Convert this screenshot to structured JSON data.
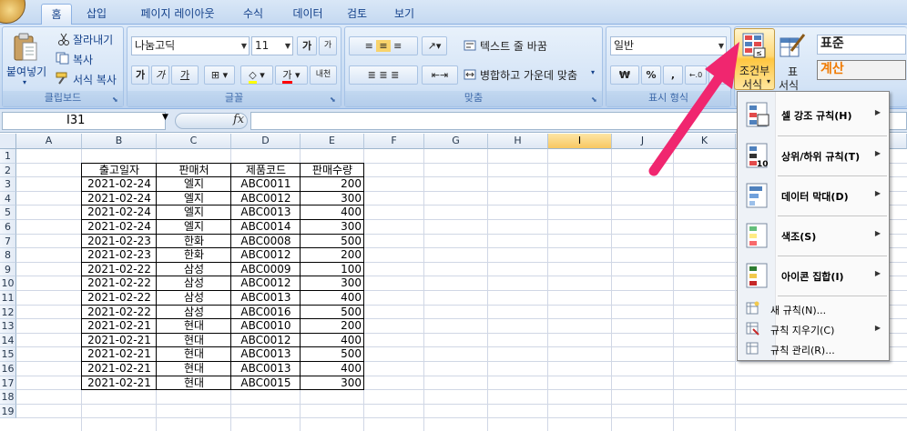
{
  "tabs": [
    {
      "label": "홈",
      "active": true
    },
    {
      "label": "삽입"
    },
    {
      "label": "페이지 레이아웃"
    },
    {
      "label": "수식"
    },
    {
      "label": "데이터"
    },
    {
      "label": "검토"
    },
    {
      "label": "보기"
    }
  ],
  "ribbon": {
    "clipboard": {
      "group_label": "클립보드",
      "paste_label": "붙여넣기",
      "cut_label": "잘라내기",
      "copy_label": "복사",
      "format_painter_label": "서식 복사"
    },
    "font": {
      "group_label": "글꼴",
      "font_name": "나눔고딕",
      "font_size": "11",
      "bold_label": "가",
      "italic_label": "가",
      "underline_label": "가",
      "grow_label": "가",
      "fontcolor_label": "가",
      "phonetic_label": "내천"
    },
    "alignment": {
      "group_label": "맞춤",
      "wrap_label": "텍스트 줄 바꿈",
      "merge_label": "병합하고 가운데 맞춤"
    },
    "number": {
      "group_label": "표시 형식",
      "format_value": "일반",
      "currency_label": "₩",
      "percent_label": "%",
      "comma_label": ","
    },
    "styles": {
      "cf_label_line1": "조건부",
      "cf_label_line2": "서식",
      "table_label_line1": "표",
      "table_label_line2": "서식",
      "style_normal": "표준",
      "style_calc": "계산"
    }
  },
  "formula_bar": {
    "name_box": "I31",
    "fx": "fx",
    "formula": ""
  },
  "columns": [
    "A",
    "B",
    "C",
    "D",
    "E",
    "F",
    "G",
    "H",
    "I",
    "J",
    "K"
  ],
  "rows": [
    "1",
    "2",
    "3",
    "4",
    "5",
    "6",
    "7",
    "8",
    "9",
    "10",
    "11",
    "12",
    "13",
    "14",
    "15",
    "16",
    "17",
    "18",
    "19"
  ],
  "table": {
    "headers": [
      "출고일자",
      "판매처",
      "제품코드",
      "판매수량"
    ],
    "rows": [
      [
        "2021-02-24",
        "엘지",
        "ABC0011",
        "200"
      ],
      [
        "2021-02-24",
        "엘지",
        "ABC0012",
        "300"
      ],
      [
        "2021-02-24",
        "엘지",
        "ABC0013",
        "400"
      ],
      [
        "2021-02-24",
        "엘지",
        "ABC0014",
        "300"
      ],
      [
        "2021-02-23",
        "한화",
        "ABC0008",
        "500"
      ],
      [
        "2021-02-23",
        "한화",
        "ABC0012",
        "200"
      ],
      [
        "2021-02-22",
        "삼성",
        "ABC0009",
        "100"
      ],
      [
        "2021-02-22",
        "삼성",
        "ABC0012",
        "300"
      ],
      [
        "2021-02-22",
        "삼성",
        "ABC0013",
        "400"
      ],
      [
        "2021-02-22",
        "삼성",
        "ABC0016",
        "500"
      ],
      [
        "2021-02-21",
        "현대",
        "ABC0010",
        "200"
      ],
      [
        "2021-02-21",
        "현대",
        "ABC0012",
        "400"
      ],
      [
        "2021-02-21",
        "현대",
        "ABC0013",
        "500"
      ],
      [
        "2021-02-21",
        "현대",
        "ABC0013",
        "400"
      ],
      [
        "2021-02-21",
        "현대",
        "ABC0015",
        "300"
      ]
    ]
  },
  "menu": {
    "big_items": [
      {
        "label": "셀 강조 규칙(H)",
        "icon": "highlight-rules-icon"
      },
      {
        "label": "상위/하위 규칙(T)",
        "icon": "top-bottom-rules-icon"
      },
      {
        "label": "데이터 막대(D)",
        "icon": "data-bars-icon"
      },
      {
        "label": "색조(S)",
        "icon": "color-scales-icon"
      },
      {
        "label": "아이콘 집합(I)",
        "icon": "icon-sets-icon"
      }
    ],
    "small_items": [
      {
        "label": "새 규칙(N)...",
        "icon": "new-rule-icon"
      },
      {
        "label": "규칙 지우기(C)",
        "icon": "clear-rules-icon"
      },
      {
        "label": "규칙 관리(R)...",
        "icon": "manage-rules-icon"
      }
    ]
  },
  "colors": {
    "arrow": "#f0266f",
    "selected_column": "#f8c862",
    "ribbon_text": "#15428b",
    "calc_style_text": "#f07a00"
  }
}
